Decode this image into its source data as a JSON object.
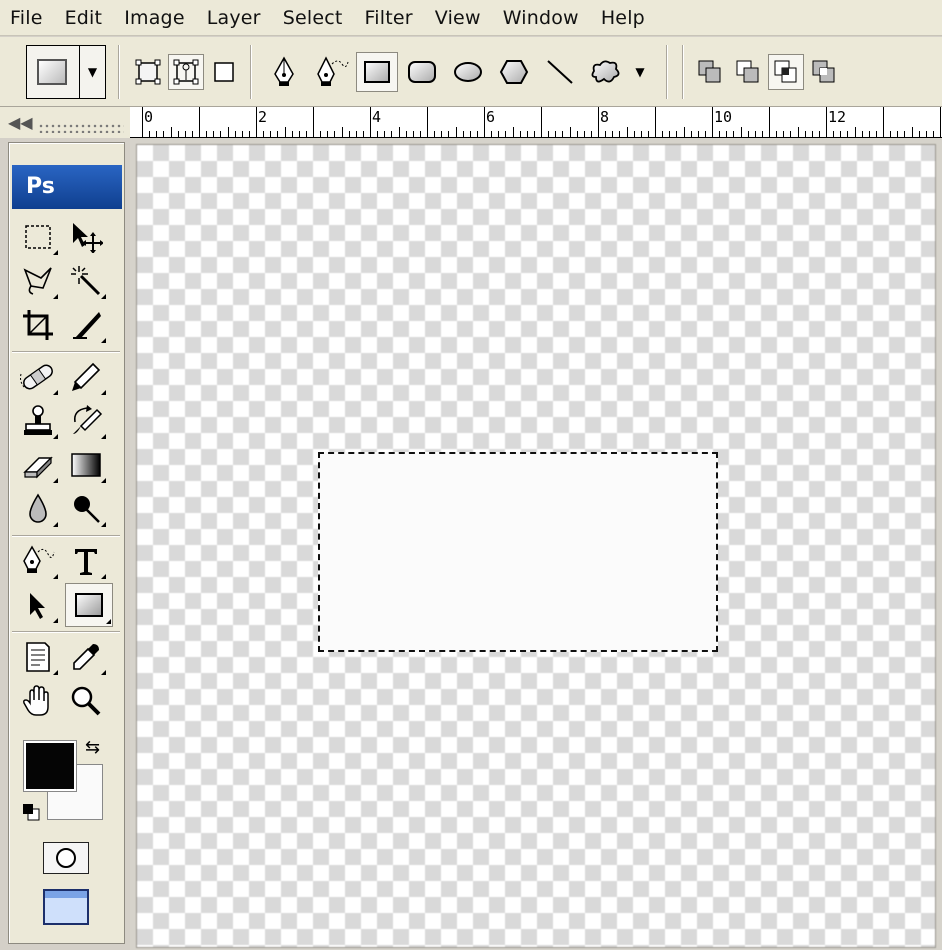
{
  "menu": {
    "items": [
      "File",
      "Edit",
      "Image",
      "Layer",
      "Select",
      "Filter",
      "View",
      "Window",
      "Help"
    ]
  },
  "options_bar": {
    "preset_icon": "rectangle-shape-preset-icon",
    "mode_icons": [
      "shape-layers-icon",
      "paths-icon",
      "fill-pixels-icon"
    ],
    "shape_icons": [
      "pen-icon",
      "freeform-pen-icon",
      "rectangle-icon",
      "rounded-rectangle-icon",
      "ellipse-icon",
      "polygon-icon",
      "line-icon",
      "custom-shape-icon"
    ],
    "combine_icons": [
      "add-to-shape-area-icon",
      "subtract-from-shape-area-icon",
      "intersect-shape-areas-icon",
      "exclude-overlapping-shape-areas-icon"
    ]
  },
  "ruler": {
    "labels": [
      "0",
      "2",
      "4",
      "6",
      "8",
      "10",
      "12"
    ]
  },
  "toolbox": {
    "logo_text": "Ps",
    "foreground_color": "#050505",
    "background_color": "#fafafa",
    "selected_tool": "rectangle-tool"
  },
  "canvas": {
    "transparency_pattern": "checkerboard",
    "selection": "rectangular-marquee"
  }
}
